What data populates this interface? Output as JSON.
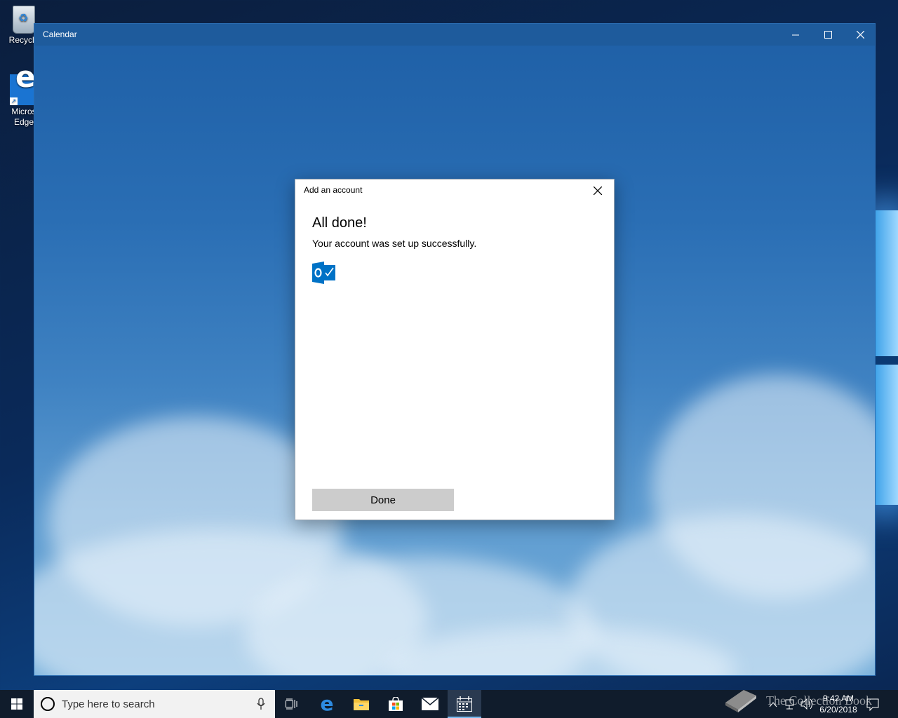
{
  "desktop": {
    "icons": [
      {
        "label": "Recycle"
      },
      {
        "label_line1": "Micros",
        "label_line2": "Edge"
      }
    ]
  },
  "window": {
    "title": "Calendar"
  },
  "dialog": {
    "title": "Add an account",
    "heading": "All done!",
    "message": "Your account was set up successfully.",
    "done_label": "Done"
  },
  "taskbar": {
    "search_placeholder": "Type here to search",
    "apps": [
      "start-icon",
      "task-view-icon",
      "edge-icon",
      "file-explorer-icon",
      "store-icon",
      "mail-icon",
      "calendar-icon"
    ],
    "active_app": "calendar-icon",
    "time": "9:42 AM",
    "date": "6/20/2018"
  },
  "watermark": "The Collection Book",
  "colors": {
    "titlebar": "#1e5b9c",
    "taskbar": "#101c2c",
    "button": "#cccccc",
    "outlook_blue": "#0072c6"
  }
}
